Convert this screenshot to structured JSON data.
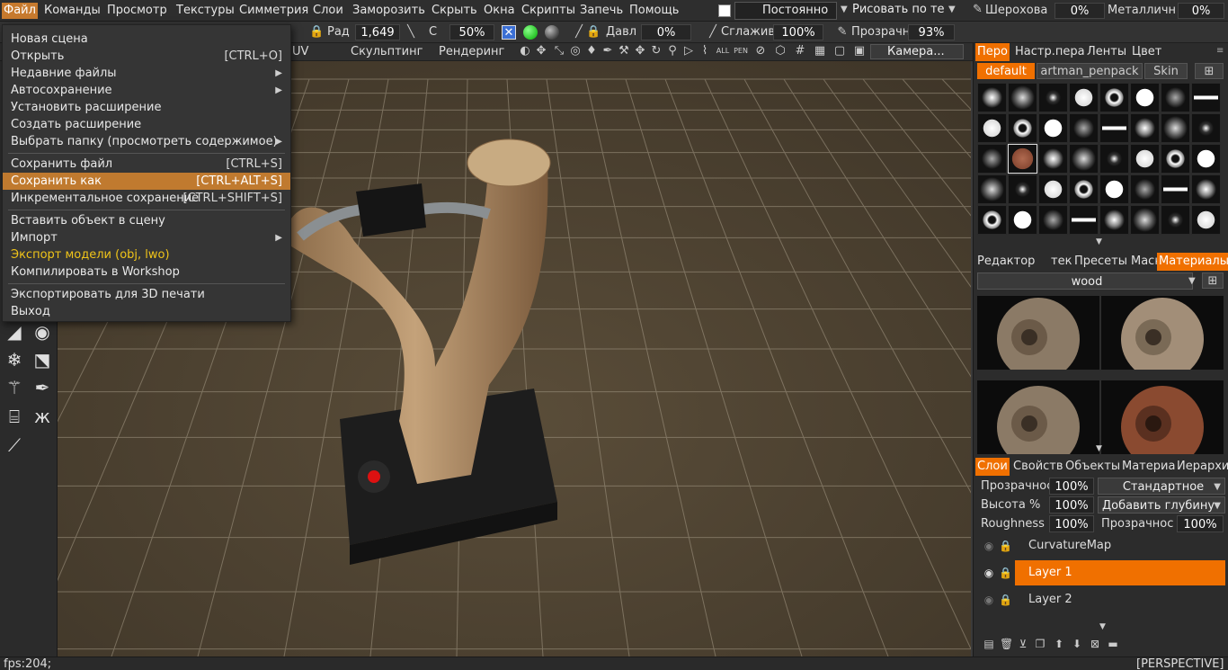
{
  "menubar": {
    "items": [
      "Файл",
      "Команды",
      "Просмотр",
      "Текстуры",
      "Симметрия",
      "Слои",
      "Заморозить",
      "Скрыть",
      "Окна",
      "Скрипты",
      "Запечь",
      "Помощь"
    ],
    "mode_value": "Постоянно",
    "paint_mode": "Рисовать по те",
    "roughness_label": "Шерохова",
    "roughness_value": "0%",
    "metal_label": "Металличн",
    "metal_value": "0%"
  },
  "toolbar": {
    "radius_label": "Рад",
    "radius_value": "1,649",
    "c_label": "C",
    "c_value": "50%",
    "pressure_label": "Давл",
    "pressure_value": "0%",
    "smooth_label": "Сглажив",
    "smooth_value": "100%",
    "opacity_label": "Прозрачн",
    "opacity_value": "93%"
  },
  "rooms": {
    "uv_tab": "UV",
    "sculpt_tab": "Скульптинг",
    "render_tab": "Рендеринг",
    "camera_select": "Камера..."
  },
  "file_menu": {
    "items": [
      {
        "label": "Новая сцена"
      },
      {
        "label": "Открыть",
        "shortcut": "[CTRL+O]"
      },
      {
        "label": "Недавние файлы",
        "submenu": "▶"
      },
      {
        "label": "Автосохранение",
        "submenu": "▶"
      },
      {
        "label": "Установить расширение"
      },
      {
        "label": "Создать расширение"
      },
      {
        "label": "Выбрать папку (просмотреть содержимое)",
        "submenu": "▶"
      },
      {
        "label": "Сохранить файл",
        "shortcut": "[CTRL+S]"
      },
      {
        "label": "Сохранить как",
        "shortcut": "[CTRL+ALT+S]"
      },
      {
        "label": "Инкрементальное сохранение",
        "shortcut": "[CTRL+SHIFT+S]"
      },
      {
        "label": "Вставить объект в сцену"
      },
      {
        "label": "Импорт",
        "submenu": "▶"
      },
      {
        "label": "Экспорт модели (obj, lwo)"
      },
      {
        "label": "Компилировать в Workshop"
      },
      {
        "label": "Экспортировать для 3D печати"
      },
      {
        "label": "Выход"
      }
    ]
  },
  "brush_panel": {
    "tabs": [
      "Перо",
      "Настр.пера",
      "Ленты",
      "Цвет"
    ],
    "presets": [
      "default",
      "artman_penpack",
      "Skin"
    ]
  },
  "materials_panel": {
    "tabs": [
      "Редактор",
      "тек",
      "Пресеты",
      "Маски",
      "Материалы"
    ],
    "selected": "wood"
  },
  "layers_panel": {
    "tabs": [
      "Слои",
      "Свойств",
      "Объекты",
      "Материа",
      "Иерархи"
    ],
    "opacity_label": "Прозрачнос",
    "opacity_value": "100%",
    "blend_mode": "Стандартное",
    "height_label": "Высота %",
    "height_value": "100%",
    "depth_mode": "Добавить глубину",
    "roughness_label": "Roughness",
    "roughness_value": "100%",
    "opacity2_label": "Прозрачнос",
    "opacity2_value": "100%",
    "layers": [
      {
        "name": "CurvatureMap"
      },
      {
        "name": "Layer 1"
      },
      {
        "name": "Layer 2"
      }
    ]
  },
  "status": {
    "fps": "fps:204;",
    "view": "[PERSPECTIVE]"
  },
  "colors": {
    "accent": "#f07000",
    "menu_highlight": "#c07a2f",
    "export_text": "#f0c419",
    "viewport_bg": "#4d4332"
  }
}
